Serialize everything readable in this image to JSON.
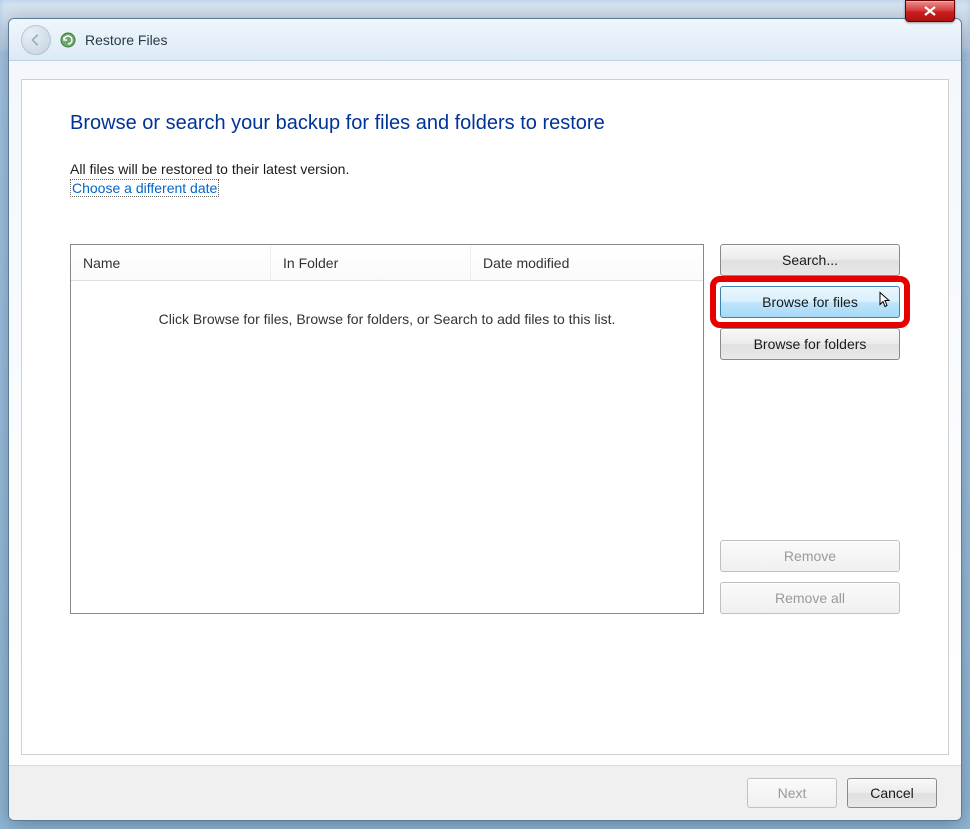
{
  "window": {
    "close_label": "X",
    "title": "Restore Files"
  },
  "main": {
    "heading": "Browse or search your backup for files and folders to restore",
    "subtext": "All files will be restored to their latest version.",
    "link": "Choose a different date",
    "columns": {
      "name": "Name",
      "folder": "In Folder",
      "date": "Date modified"
    },
    "empty_hint": "Click Browse for files, Browse for folders, or Search to add files to this list."
  },
  "buttons": {
    "search": "Search...",
    "browse_files": "Browse for files",
    "browse_folders": "Browse for folders",
    "remove": "Remove",
    "remove_all": "Remove all"
  },
  "footer": {
    "next": "Next",
    "cancel": "Cancel"
  }
}
